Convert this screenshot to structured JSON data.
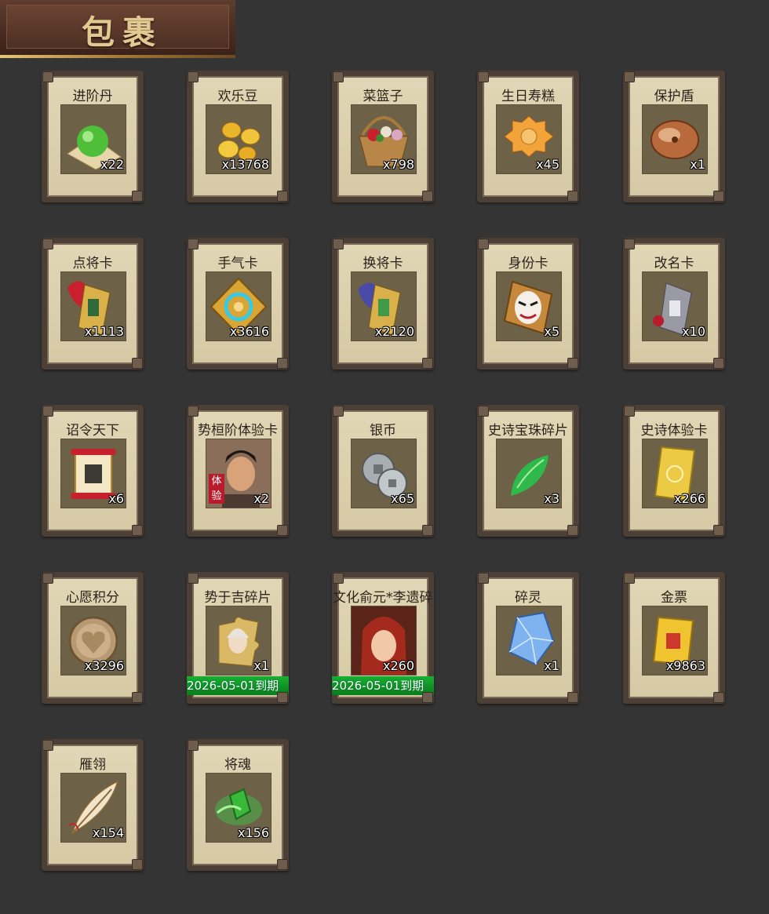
{
  "header": {
    "title": "包裹"
  },
  "items": [
    {
      "name": "进阶丹",
      "qty": "x22",
      "icon": "green-orb-icon"
    },
    {
      "name": "欢乐豆",
      "qty": "x13768",
      "icon": "gold-beans-icon"
    },
    {
      "name": "菜篮子",
      "qty": "x798",
      "icon": "basket-icon"
    },
    {
      "name": "生日寿糕",
      "qty": "x45",
      "icon": "cake-icon"
    },
    {
      "name": "保护盾",
      "qty": "x1",
      "icon": "shield-icon"
    },
    {
      "name": "点将卡",
      "qty": "x1113",
      "icon": "general-card-icon"
    },
    {
      "name": "手气卡",
      "qty": "x3616",
      "icon": "luck-card-icon"
    },
    {
      "name": "换将卡",
      "qty": "x2120",
      "icon": "swap-card-icon"
    },
    {
      "name": "身份卡",
      "qty": "x5",
      "icon": "mask-card-icon"
    },
    {
      "name": "改名卡",
      "qty": "x10",
      "icon": "rename-card-icon"
    },
    {
      "name": "诏令天下",
      "qty": "x6",
      "icon": "scroll-icon"
    },
    {
      "name": "势桓阶体验卡",
      "qty": "x2",
      "icon": "portrait-icon",
      "badge": "体验"
    },
    {
      "name": "银币",
      "qty": "x65",
      "icon": "silver-coin-icon"
    },
    {
      "name": "史诗宝珠碎片",
      "qty": "x3",
      "icon": "green-leaf-icon"
    },
    {
      "name": "史诗体验卡",
      "qty": "x266",
      "icon": "gold-card-icon"
    },
    {
      "name": "心愿积分",
      "qty": "x3296",
      "icon": "heart-coin-icon"
    },
    {
      "name": "势于吉碎片",
      "qty": "x1",
      "icon": "puzzle-portrait-icon",
      "expire": "2026-05-01到期"
    },
    {
      "name": "文化俞元*李遗碎片",
      "qty": "x260",
      "icon": "red-portrait-icon",
      "expire": "2026-05-01到期"
    },
    {
      "name": "碎灵",
      "qty": "x1",
      "icon": "crystal-icon"
    },
    {
      "name": "金票",
      "qty": "x9863",
      "icon": "gold-ticket-icon"
    },
    {
      "name": "雁翎",
      "qty": "x154",
      "icon": "feather-icon"
    },
    {
      "name": "将魂",
      "qty": "x156",
      "icon": "green-soul-icon"
    }
  ]
}
